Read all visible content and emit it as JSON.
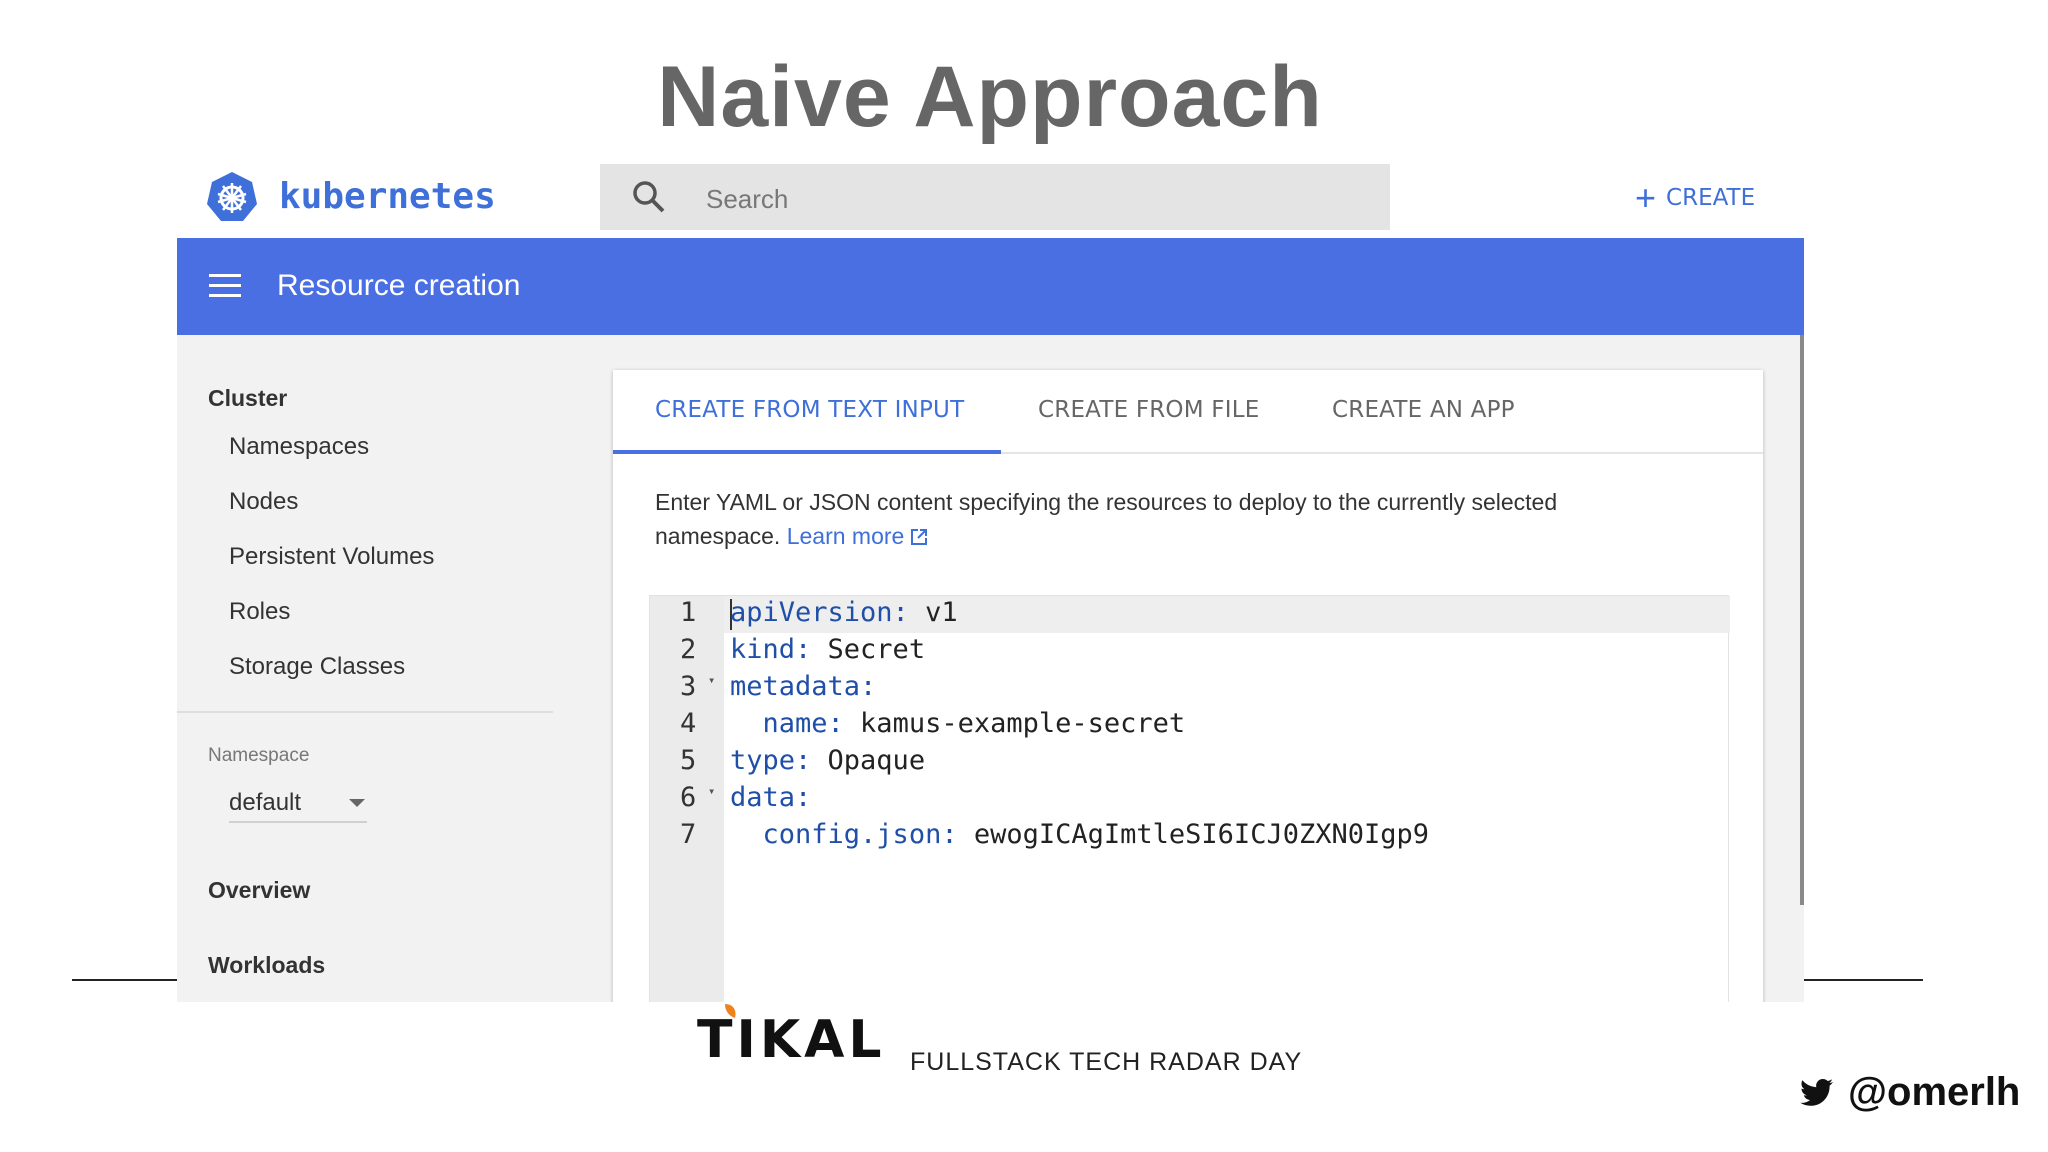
{
  "slide": {
    "title": "Naive Approach"
  },
  "topbar": {
    "brand": "kubernetes",
    "search_placeholder": "Search",
    "create_label": "CREATE"
  },
  "header": {
    "title": "Resource creation"
  },
  "sidebar": {
    "cluster_heading": "Cluster",
    "cluster_items": [
      "Namespaces",
      "Nodes",
      "Persistent Volumes",
      "Roles",
      "Storage Classes"
    ],
    "namespace_label": "Namespace",
    "namespace_value": "default",
    "overview": "Overview",
    "workloads": "Workloads"
  },
  "tabs": [
    "CREATE FROM TEXT INPUT",
    "CREATE FROM FILE",
    "CREATE AN APP"
  ],
  "description": {
    "line1": "Enter YAML or JSON content specifying the resources to deploy to the currently selected",
    "line2": "namespace.",
    "link": "Learn more"
  },
  "editor": {
    "lines": [
      {
        "n": "1",
        "key": "apiVersion:",
        "val": " v1",
        "indent": "",
        "fold": false
      },
      {
        "n": "2",
        "key": "kind:",
        "val": " Secret",
        "indent": "",
        "fold": false
      },
      {
        "n": "3",
        "key": "metadata:",
        "val": "",
        "indent": "",
        "fold": true
      },
      {
        "n": "4",
        "key": "name:",
        "val": " kamus-example-secret",
        "indent": "  ",
        "fold": false
      },
      {
        "n": "5",
        "key": "type:",
        "val": " Opaque",
        "indent": "",
        "fold": false
      },
      {
        "n": "6",
        "key": "data:",
        "val": "",
        "indent": "",
        "fold": true
      },
      {
        "n": "7",
        "key": "config.json:",
        "val": " ewogICAgImtleSI6ICJ0ZXN0Igp9",
        "indent": "  ",
        "fold": false
      }
    ]
  },
  "footer": {
    "logo": "TIKAL",
    "tagline": "FULLSTACK TECH RADAR DAY",
    "twitter_handle": "@omerlh"
  },
  "colors": {
    "accent": "#4a6fe3",
    "brand": "#3f6fd8"
  },
  "icons": [
    "kubernetes-logo-icon",
    "search-icon",
    "plus-icon",
    "hamburger-icon",
    "dropdown-caret-icon",
    "external-link-icon",
    "twitter-icon"
  ]
}
